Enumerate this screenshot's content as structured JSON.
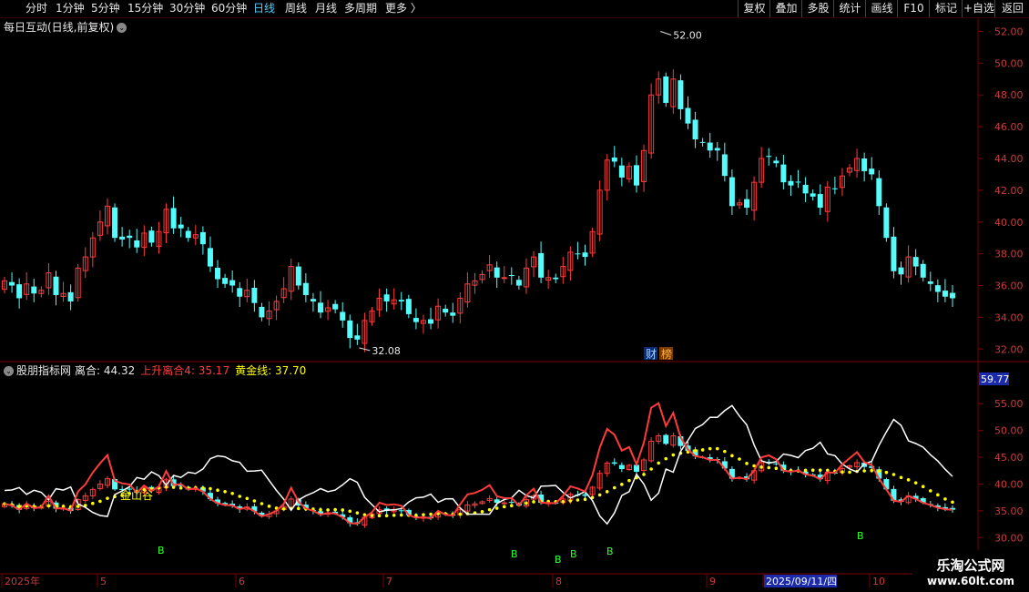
{
  "toolbar": {
    "left_items": [
      {
        "label": "分时",
        "active": false
      },
      {
        "label": "1分钟",
        "active": false
      },
      {
        "label": "5分钟",
        "active": false
      },
      {
        "label": "15分钟",
        "active": false
      },
      {
        "label": "30分钟",
        "active": false
      },
      {
        "label": "60分钟",
        "active": false
      },
      {
        "label": "日线",
        "active": true
      },
      {
        "label": "周线",
        "active": false
      },
      {
        "label": "月线",
        "active": false
      },
      {
        "label": "多周期",
        "active": false
      },
      {
        "label": "更多 〉",
        "active": false
      }
    ],
    "right_items": [
      "复权",
      "叠加",
      "多股",
      "统计",
      "画线",
      "F10",
      "标记",
      "+自选",
      "返回"
    ]
  },
  "main_chart": {
    "title": "每日互动(日线,前复权)",
    "y_ticks": [
      "52.00",
      "50.00",
      "48.00",
      "46.00",
      "44.00",
      "42.00",
      "40.00",
      "38.00",
      "36.00",
      "34.00",
      "32.00"
    ],
    "high_label": "52.00",
    "low_label": "32.08",
    "badges": [
      "财",
      "榜"
    ]
  },
  "indicator": {
    "name": "股朋指标网",
    "label1": "离合: 44.32",
    "label2": "上升离合4: 35.17",
    "label3": "黄金线: 37.70",
    "y_ticks": [
      "55.00",
      "50.00",
      "45.00",
      "40.00",
      "35.00",
      "30.00"
    ],
    "current_value": "59.77",
    "annotation": "金山谷",
    "b_marker": "B"
  },
  "x_axis": {
    "labels": [
      "2025年",
      "5",
      "6",
      "7",
      "8",
      "9",
      "2025/09/11/四",
      "10"
    ]
  },
  "watermark": {
    "line1": "乐淘公式网",
    "line2": "www.60lt.com"
  },
  "colors": {
    "up": "#ff3b3b",
    "down": "#54fcfc",
    "grid": "#7a0000",
    "gold": "#ffff00",
    "axis_text": "#cc3b3b"
  },
  "chart_data": {
    "type": "candlestick",
    "title": "每日互动(日线,前复权)",
    "y_range": [
      31.5,
      52.6
    ],
    "high": 52.0,
    "low": 32.08,
    "closes": [
      36.3,
      36.0,
      35.2,
      36.1,
      35.5,
      35.7,
      36.8,
      35.4,
      35.5,
      35.0,
      37.1,
      37.8,
      39.0,
      40.0,
      41.0,
      39.0,
      38.9,
      39.0,
      38.4,
      39.3,
      38.7,
      39.4,
      40.8,
      39.6,
      39.6,
      39.0,
      39.2,
      38.6,
      37.2,
      36.4,
      36.1,
      36.0,
      35.3,
      35.7,
      34.9,
      34.0,
      34.4,
      35.0,
      35.8,
      37.2,
      36.0,
      35.4,
      35.0,
      34.3,
      34.6,
      34.5,
      33.8,
      32.7,
      32.6,
      33.8,
      34.4,
      35.2,
      35.0,
      35.1,
      35.0,
      34.2,
      33.7,
      33.8,
      33.6,
      34.7,
      34.3,
      34.1,
      35.2,
      36.1,
      36.3,
      36.7,
      37.3,
      36.5,
      36.5,
      36.6,
      36.0,
      37.1,
      37.8,
      36.5,
      36.5,
      36.4,
      37.2,
      38.1,
      38.0,
      37.8,
      39.4,
      42.0,
      43.9,
      43.8,
      42.8,
      43.5,
      42.3,
      44.5,
      48.0,
      49.0,
      47.5,
      49.0,
      47.1,
      46.2,
      45.2,
      45.0,
      44.5,
      44.5,
      42.9,
      41.0,
      41.2,
      40.9,
      42.5,
      44.0,
      44.1,
      43.7,
      42.5,
      42.3,
      42.5,
      41.8,
      41.6,
      40.9,
      42.2,
      42.1,
      42.9,
      43.4,
      44.0,
      43.2,
      43.0,
      41.0,
      39.0,
      36.9,
      36.7,
      37.8,
      37.2,
      36.5,
      36.1,
      35.6,
      35.3,
      35.2
    ],
    "indicator_series": [
      {
        "name": "离合",
        "last": 44.32
      },
      {
        "name": "上升离合4",
        "last": 35.17
      },
      {
        "name": "黄金线",
        "last": 37.7
      }
    ],
    "indicator_y_range": [
      27.5,
      59.8
    ]
  }
}
